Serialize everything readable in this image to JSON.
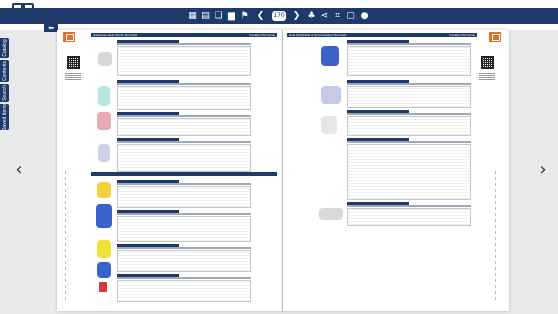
{
  "toolbar": {
    "icons": [
      "grid-icon",
      "list-icon",
      "bookmark-icon",
      "notes-icon",
      "cart-icon",
      "prev-page-icon",
      "next-page-icon",
      "print-icon",
      "share-icon",
      "crop-icon",
      "fullscreen-icon",
      "info-icon"
    ],
    "page_number": "170",
    "back_icon": "back-arrow-icon"
  },
  "sidebar": {
    "tabs": [
      {
        "label": "Catalog"
      },
      {
        "label": "Contents"
      },
      {
        "label": "Search"
      },
      {
        "label": "Saved Items"
      }
    ]
  },
  "nav": {
    "prev_glyph": "‹",
    "next_glyph": "›"
  },
  "book": {
    "left_page": {
      "header_left": "Solderless Heat Shrink Terminals",
      "header_right": "Insulated Terminals"
    },
    "right_page": {
      "header_left": "Heat Shrinkable & Non-Insulated Terminals",
      "header_right": "Insulated Terminals"
    }
  },
  "colors": {
    "brand": "#1d3a6a",
    "accent": "#e0732a",
    "background": "#e9eaec"
  }
}
